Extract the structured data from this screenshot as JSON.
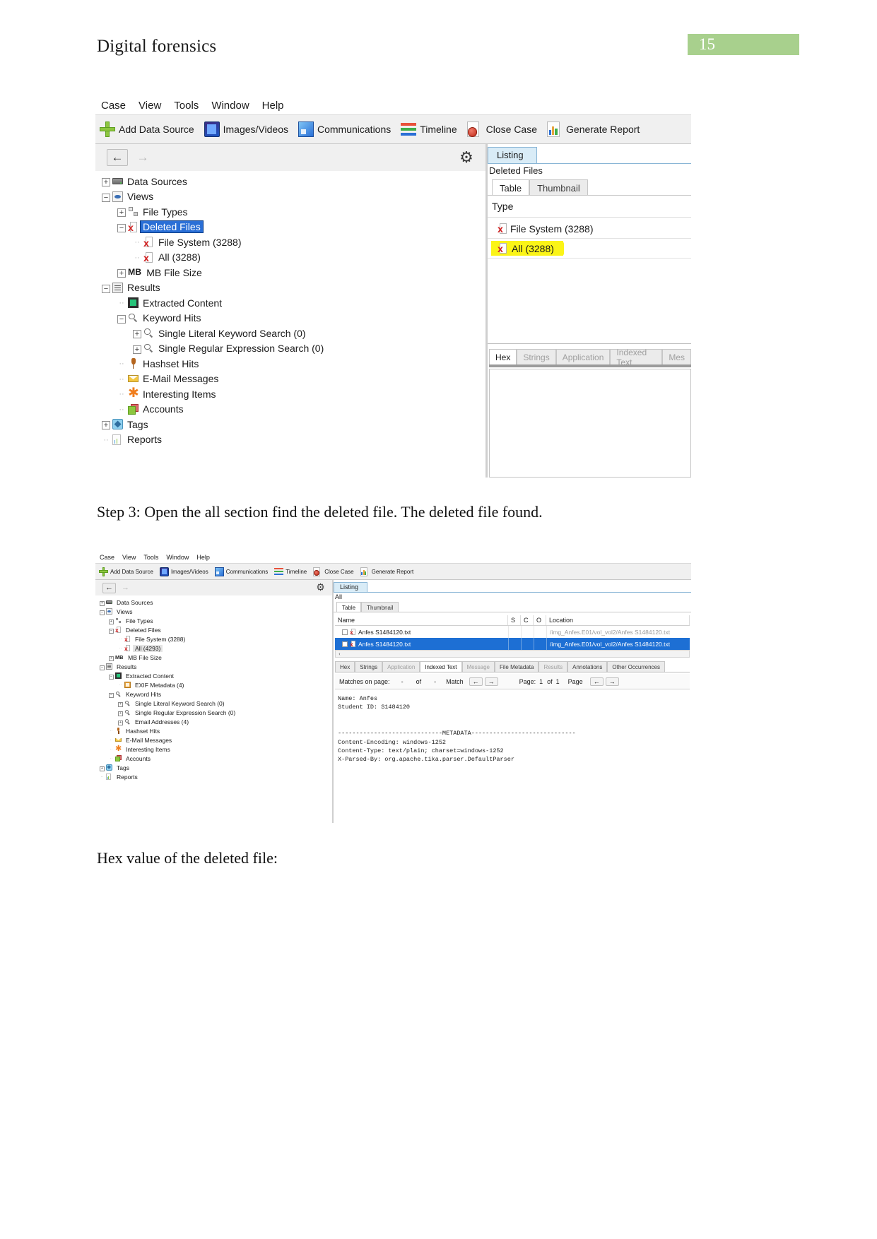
{
  "document": {
    "header_title": "Digital forensics",
    "page_number": "15",
    "badge_color": "#a8d08d"
  },
  "captions": {
    "step3": "Step 3: Open the all section find the deleted file. The deleted file found.",
    "hex_value": "Hex value of the deleted file:"
  },
  "screenshot1": {
    "menubar": [
      "Case",
      "View",
      "Tools",
      "Window",
      "Help"
    ],
    "toolbar": [
      {
        "label": "Add Data Source",
        "icon": "plus-icon"
      },
      {
        "label": "Images/Videos",
        "icon": "images-videos-icon"
      },
      {
        "label": "Communications",
        "icon": "communications-icon"
      },
      {
        "label": "Timeline",
        "icon": "timeline-icon"
      },
      {
        "label": "Close Case",
        "icon": "close-case-icon"
      },
      {
        "label": "Generate Report",
        "icon": "generate-report-icon"
      }
    ],
    "nav": {
      "back": "←",
      "forward": "→",
      "gear": "⚙"
    },
    "tree": [
      {
        "label": "Data Sources",
        "indent": 0,
        "handle": "+",
        "icon": "drive-icon"
      },
      {
        "label": "Views",
        "indent": 0,
        "handle": "-",
        "icon": "eye-icon"
      },
      {
        "label": "File Types",
        "indent": 1,
        "handle": "+",
        "icon": "file-types-icon"
      },
      {
        "label": "Deleted Files",
        "indent": 1,
        "handle": "-",
        "icon": "deleted-file-icon",
        "select": "blue"
      },
      {
        "label": "File System (3288)",
        "indent": 2,
        "handle": "",
        "icon": "deleted-file-icon"
      },
      {
        "label": "All (3288)",
        "indent": 2,
        "handle": "",
        "icon": "deleted-file-icon"
      },
      {
        "label": "MB File Size",
        "indent": 1,
        "handle": "+",
        "icon": "mb-icon"
      },
      {
        "label": "Results",
        "indent": 0,
        "handle": "-",
        "icon": "results-icon"
      },
      {
        "label": "Extracted Content",
        "indent": 1,
        "handle": "",
        "icon": "extracted-content-icon"
      },
      {
        "label": "Keyword Hits",
        "indent": 1,
        "handle": "-",
        "icon": "search-icon"
      },
      {
        "label": "Single Literal Keyword Search (0)",
        "indent": 2,
        "handle": "+",
        "icon": "search-icon"
      },
      {
        "label": "Single Regular Expression Search (0)",
        "indent": 2,
        "handle": "+",
        "icon": "search-icon"
      },
      {
        "label": "Hashset Hits",
        "indent": 1,
        "handle": "",
        "icon": "pin-icon"
      },
      {
        "label": "E-Mail Messages",
        "indent": 1,
        "handle": "",
        "icon": "envelope-icon"
      },
      {
        "label": "Interesting Items",
        "indent": 1,
        "handle": "",
        "icon": "star-icon"
      },
      {
        "label": "Accounts",
        "indent": 1,
        "handle": "",
        "icon": "accounts-icon"
      },
      {
        "label": "Tags",
        "indent": 0,
        "handle": "+",
        "icon": "tag-icon"
      },
      {
        "label": "Reports",
        "indent": 0,
        "handle": "",
        "icon": "report-icon"
      }
    ],
    "listing": {
      "tab_listing": "Listing",
      "subtitle": "Deleted Files",
      "view_tabs": [
        "Table",
        "Thumbnail"
      ],
      "active_view_tab": "Table",
      "column_header": "Type",
      "rows": [
        {
          "label": "File System (3288)",
          "highlight": false
        },
        {
          "label": "All (3288)",
          "highlight": true
        }
      ]
    },
    "bottom_tabs": [
      "Hex",
      "Strings",
      "Application",
      "Indexed Text",
      "Mes"
    ],
    "bottom_active_tab": "Hex"
  },
  "screenshot2": {
    "menubar": [
      "Case",
      "View",
      "Tools",
      "Window",
      "Help"
    ],
    "toolbar": [
      {
        "label": "Add Data Source",
        "icon": "plus-icon"
      },
      {
        "label": "Images/Videos",
        "icon": "images-videos-icon"
      },
      {
        "label": "Communications",
        "icon": "communications-icon"
      },
      {
        "label": "Timeline",
        "icon": "timeline-icon"
      },
      {
        "label": "Close Case",
        "icon": "close-case-icon"
      },
      {
        "label": "Generate Report",
        "icon": "generate-report-icon"
      }
    ],
    "nav": {
      "back": "←",
      "forward": "→",
      "gear": "⚙"
    },
    "tree": [
      {
        "label": "Data Sources",
        "indent": 0,
        "handle": "+",
        "icon": "drive-icon"
      },
      {
        "label": "Views",
        "indent": 0,
        "handle": "-",
        "icon": "eye-icon"
      },
      {
        "label": "File Types",
        "indent": 1,
        "handle": "+",
        "icon": "file-types-icon"
      },
      {
        "label": "Deleted Files",
        "indent": 1,
        "handle": "-",
        "icon": "deleted-file-icon"
      },
      {
        "label": "File System (3288)",
        "indent": 2,
        "handle": "",
        "icon": "deleted-file-icon"
      },
      {
        "label": "All (4293)",
        "indent": 2,
        "handle": "",
        "icon": "deleted-file-icon",
        "select": "grey"
      },
      {
        "label": "MB File Size",
        "indent": 1,
        "handle": "+",
        "icon": "mb-icon"
      },
      {
        "label": "Results",
        "indent": 0,
        "handle": "-",
        "icon": "results-icon"
      },
      {
        "label": "Extracted Content",
        "indent": 1,
        "handle": "-",
        "icon": "extracted-content-icon"
      },
      {
        "label": "EXIF Metadata (4)",
        "indent": 2,
        "handle": "",
        "icon": "exif-icon"
      },
      {
        "label": "Keyword Hits",
        "indent": 1,
        "handle": "-",
        "icon": "search-icon"
      },
      {
        "label": "Single Literal Keyword Search (0)",
        "indent": 2,
        "handle": "+",
        "icon": "search-icon"
      },
      {
        "label": "Single Regular Expression Search (0)",
        "indent": 2,
        "handle": "+",
        "icon": "search-icon"
      },
      {
        "label": "Email Addresses (4)",
        "indent": 2,
        "handle": "+",
        "icon": "search-icon"
      },
      {
        "label": "Hashset Hits",
        "indent": 1,
        "handle": "",
        "icon": "pin-icon"
      },
      {
        "label": "E-Mail Messages",
        "indent": 1,
        "handle": "",
        "icon": "envelope-icon"
      },
      {
        "label": "Interesting Items",
        "indent": 1,
        "handle": "",
        "icon": "star-icon"
      },
      {
        "label": "Accounts",
        "indent": 1,
        "handle": "",
        "icon": "accounts-icon"
      },
      {
        "label": "Tags",
        "indent": 0,
        "handle": "+",
        "icon": "tag-icon"
      },
      {
        "label": "Reports",
        "indent": 0,
        "handle": "",
        "icon": "report-icon"
      }
    ],
    "listing": {
      "tab_listing": "Listing",
      "subtitle": "All",
      "view_tabs": [
        "Table",
        "Thumbnail"
      ],
      "active_view_tab": "Table",
      "columns": [
        "Name",
        "S",
        "C",
        "O",
        "Location"
      ],
      "rows": [
        {
          "name": "Anfes S1484120.txt",
          "s": "",
          "c": "",
          "o": "",
          "location": "/img_Anfes.E01/vol_vol2/Anfes S1484120.txt",
          "selected": false
        },
        {
          "name": "Anfes S1484120.txt",
          "s": "",
          "c": "",
          "o": "",
          "location": "/img_Anfes.E01/vol_vol2/Anfes S1484120.txt",
          "selected": true
        }
      ]
    },
    "content_tabs": [
      "Hex",
      "Strings",
      "Application",
      "Indexed Text",
      "Message",
      "File Metadata",
      "Results",
      "Annotations",
      "Other Occurrences"
    ],
    "content_active_tab": "Indexed Text",
    "content_dim_tabs": [
      "Application",
      "Message",
      "Results"
    ],
    "pager": {
      "matches_label": "Matches on page:",
      "matches_value": "-",
      "of_label": "of",
      "of_value": "-",
      "match_label": "Match",
      "page_label": "Page:",
      "page_value": "1",
      "page_of": "of",
      "page_total": "1",
      "page_word": "Page",
      "prev_icon": "←",
      "next_icon": "→"
    },
    "preview_text": "Name: Anfes\nStudent ID: S1484120\n\n\n-----------------------------METADATA-----------------------------\nContent-Encoding: windows-1252\nContent-Type: text/plain; charset=windows-1252\nX-Parsed-By: org.apache.tika.parser.DefaultParser"
  }
}
